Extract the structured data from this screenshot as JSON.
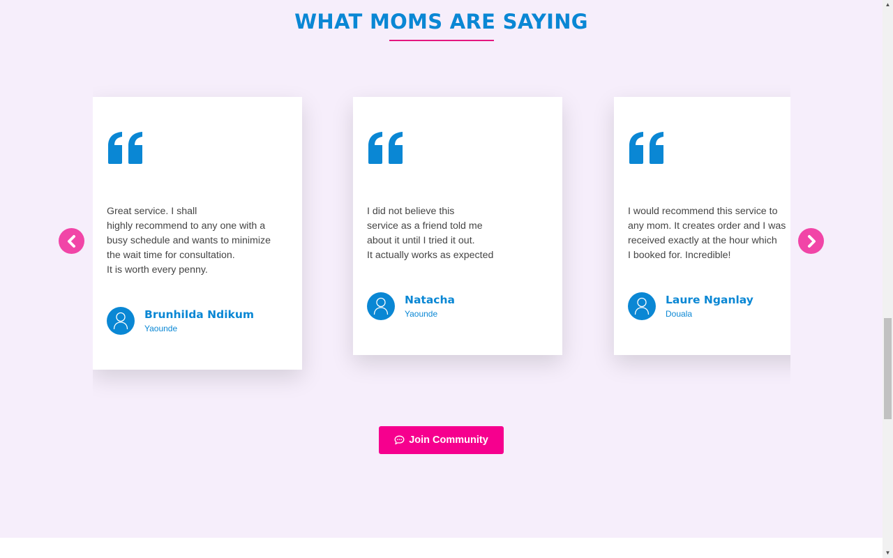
{
  "section": {
    "title": "WHAT MOMS ARE SAYING",
    "accent_color": "#0a87d4",
    "underline_color": "#e4167f"
  },
  "carousel": {
    "prev_icon": "chevron-left-icon",
    "next_icon": "chevron-right-icon",
    "testimonials": [
      {
        "text": "Great service. I shall\nhighly recommend to any one with a\nbusy schedule and wants to minimize\nthe wait time for consultation.\nIt is worth every penny.",
        "name": "Brunhilda Ndikum",
        "city": "Yaounde"
      },
      {
        "text": "I did not believe this\nservice as a friend told me\nabout it until I tried it out.\nIt actually works as expected",
        "name": "Natacha",
        "city": "Yaounde"
      },
      {
        "text": "I would recommend this service to\nany mom. It creates order and I was\nreceived exactly at the hour which\nI booked for. Incredible!",
        "name": "Laure Nganlay",
        "city": "Douala"
      }
    ]
  },
  "cta": {
    "label": "Join Community",
    "icon": "chat-bubble-icon",
    "color": "#f6008e"
  }
}
